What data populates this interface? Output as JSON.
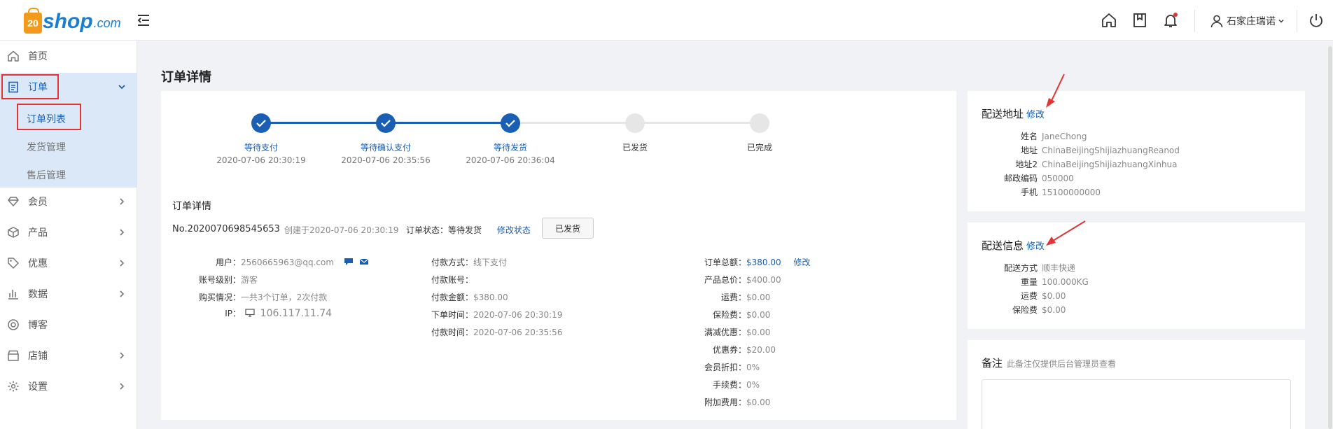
{
  "header": {
    "logo_num": "20",
    "logo_brand": "shop",
    "logo_suffix": ".com",
    "user_name": "石家庄瑞诺"
  },
  "sidebar": {
    "items": [
      {
        "label": "首页"
      },
      {
        "label": "订单"
      },
      {
        "label": "会员"
      },
      {
        "label": "产品"
      },
      {
        "label": "优惠"
      },
      {
        "label": "数据"
      },
      {
        "label": "博客"
      },
      {
        "label": "店铺"
      },
      {
        "label": "设置"
      }
    ],
    "order_sub": [
      {
        "label": "订单列表"
      },
      {
        "label": "发货管理"
      },
      {
        "label": "售后管理"
      }
    ]
  },
  "main": {
    "title": "订单详情",
    "steps": [
      {
        "label": "等待支付",
        "time": "2020-07-06 20:30:19"
      },
      {
        "label": "等待确认支付",
        "time": "2020-07-06 20:35:56"
      },
      {
        "label": "等待发货",
        "time": "2020-07-06 20:36:04"
      },
      {
        "label": "已发货",
        "time": ""
      },
      {
        "label": "已完成",
        "time": ""
      }
    ],
    "steps_done": 3,
    "detail_title": "订单详情",
    "order_no": "No.2020070698545653",
    "created": "创建于2020-07-06 20:30:19",
    "status_label": "订单状态：等待发货",
    "modify_status": "修改状态",
    "ship_button": "已发货",
    "customer": {
      "user_label": "用户：",
      "user": "2560665963@qq.com",
      "level_label": "账号级别：",
      "level": "游客",
      "purchase_label": "购买情况：",
      "purchase": "一共3个订单，2次付款",
      "ip_label": "IP：",
      "ip": "106.117.11.74"
    },
    "payment": {
      "method_label": "付款方式：",
      "method": "线下支付",
      "account_label": "付款账号：",
      "account": "",
      "amount_label": "付款金额：",
      "amount": "$380.00",
      "order_time_label": "下单时间：",
      "order_time": "2020-07-06 20:30:19",
      "pay_time_label": "付款时间：",
      "pay_time": "2020-07-06 20:35:56"
    },
    "totals": {
      "total_label": "订单总额：",
      "total": "$380.00",
      "modify": "修改",
      "rows": [
        {
          "k": "产品总价：",
          "v": "$400.00"
        },
        {
          "k": "运费：",
          "v": "$0.00"
        },
        {
          "k": "保险费：",
          "v": "$0.00"
        },
        {
          "k": "满减优惠：",
          "v": "$0.00"
        },
        {
          "k": "优惠券：",
          "v": "$20.00"
        },
        {
          "k": "会员折扣：",
          "v": "0%"
        },
        {
          "k": "手续费：",
          "v": "0%"
        },
        {
          "k": "附加费用：",
          "v": "$0.00"
        }
      ]
    }
  },
  "shipping_address": {
    "title": "配送地址",
    "modify": "修改",
    "rows": [
      {
        "k": "姓名",
        "v": "JaneChong"
      },
      {
        "k": "地址",
        "v": "ChinaBeijingShijiazhuangReanod"
      },
      {
        "k": "地址2",
        "v": "ChinaBeijingShijiazhuangXinhua"
      },
      {
        "k": "邮政编码",
        "v": "050000"
      },
      {
        "k": "手机",
        "v": "15100000000"
      }
    ]
  },
  "shipping_info": {
    "title": "配送信息",
    "modify": "修改",
    "rows": [
      {
        "k": "配送方式",
        "v": "顺丰快递"
      },
      {
        "k": "重量",
        "v": "100.000KG"
      },
      {
        "k": "运费",
        "v": "$0.00"
      },
      {
        "k": "保险费",
        "v": "$0.00"
      }
    ]
  },
  "notes": {
    "title": "备注",
    "hint": "此备注仅提供后台管理员查看"
  },
  "colors": {
    "accent": "#1a5fb4",
    "highlight_red": "#e53333",
    "active_nav_bg": "#dbe8f7"
  }
}
